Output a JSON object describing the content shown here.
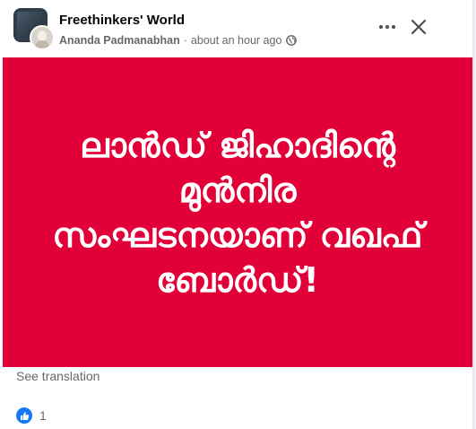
{
  "post": {
    "group_name": "Freethinkers' World",
    "author": "Ananda Padmanabhan",
    "separator": "·",
    "timestamp": "about an hour ago",
    "privacy_icon": "globe-icon",
    "more_icon": "more-horizontal-icon",
    "close_icon": "close-icon"
  },
  "media": {
    "background_color": "#e10038",
    "text_color": "#ffffff",
    "lines": [
      "ലാൻഡ് ജിഹാദിന്റെ",
      "മുൻനിര",
      "സംഘടനയാണ് വഖഫ്",
      "ബോർഡ്!"
    ]
  },
  "footer": {
    "see_translation": "See translation",
    "reaction_icon": "like-icon",
    "reaction_count": "1"
  },
  "colors": {
    "accent": "#1877f2",
    "secondary_text": "#65676b",
    "primary_text": "#050505"
  }
}
